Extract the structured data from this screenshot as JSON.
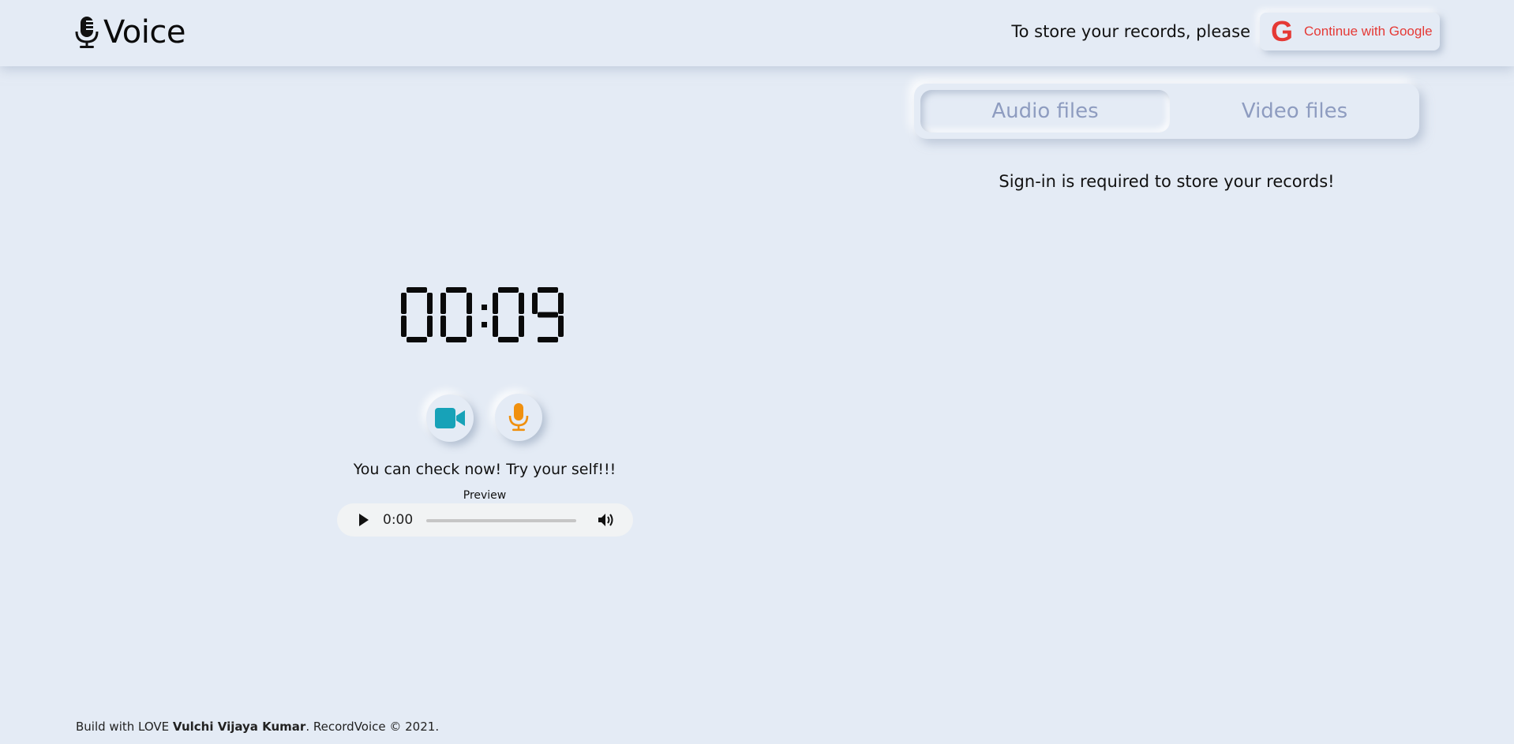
{
  "header": {
    "app_title": "Voice",
    "logo_icon": "microphone-icon",
    "store_prompt": "To store your records, please",
    "google_button_label": "Continue with Google",
    "google_icon_letter": "G"
  },
  "tabs": [
    {
      "label": "Audio files",
      "active": true
    },
    {
      "label": "Video files",
      "active": false
    }
  ],
  "signin_message": "Sign-in is required to store your records!",
  "recorder": {
    "timer": "00:09",
    "video_button_icon": "video-camera-icon",
    "mic_button_icon": "microphone-icon",
    "message": "You can check now! Try your self!!!",
    "preview_label": "Preview",
    "player": {
      "current_time": "0:00"
    }
  },
  "footer": {
    "prefix": "Build with LOVE ",
    "author": "Vulchi Vijaya Kumar",
    "suffix": ". RecordVoice © 2021."
  },
  "colors": {
    "background": "#e4ebf5",
    "google_red": "#e53935",
    "tab_text": "#8e9cc0",
    "video_icon": "#17a2b8",
    "mic_icon": "#f0900e"
  }
}
